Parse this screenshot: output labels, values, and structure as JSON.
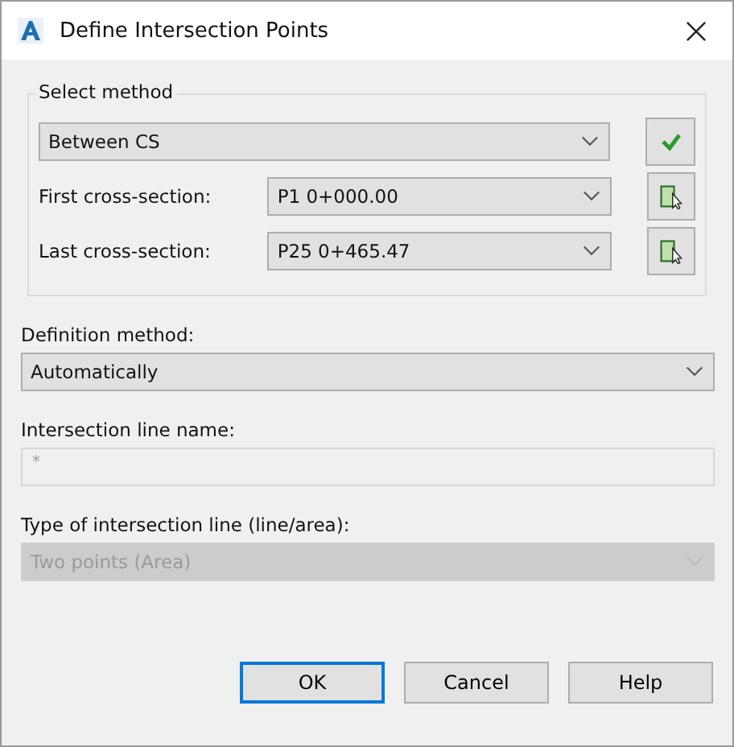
{
  "window": {
    "title": "Define Intersection Points"
  },
  "select_method": {
    "title": "Select method",
    "method": {
      "value": "Between CS"
    },
    "rows": [
      {
        "label": "First cross-section:",
        "value": "P1 0+000.00"
      },
      {
        "label": "Last cross-section:",
        "value": "P25 0+465.47"
      }
    ]
  },
  "fields": [
    {
      "kind": "dropdown",
      "label": "Definition method:",
      "value": "Automatically",
      "disabled": false
    },
    {
      "kind": "text",
      "label": "Intersection line name:",
      "value": "*",
      "disabled": true
    },
    {
      "kind": "dropdown",
      "label": "Type of intersection line (line/area):",
      "value": "Two points (Area)",
      "disabled": true
    }
  ],
  "buttons": [
    {
      "label": "OK",
      "default": true
    },
    {
      "label": "Cancel",
      "default": false
    },
    {
      "label": "Help",
      "default": false
    }
  ]
}
